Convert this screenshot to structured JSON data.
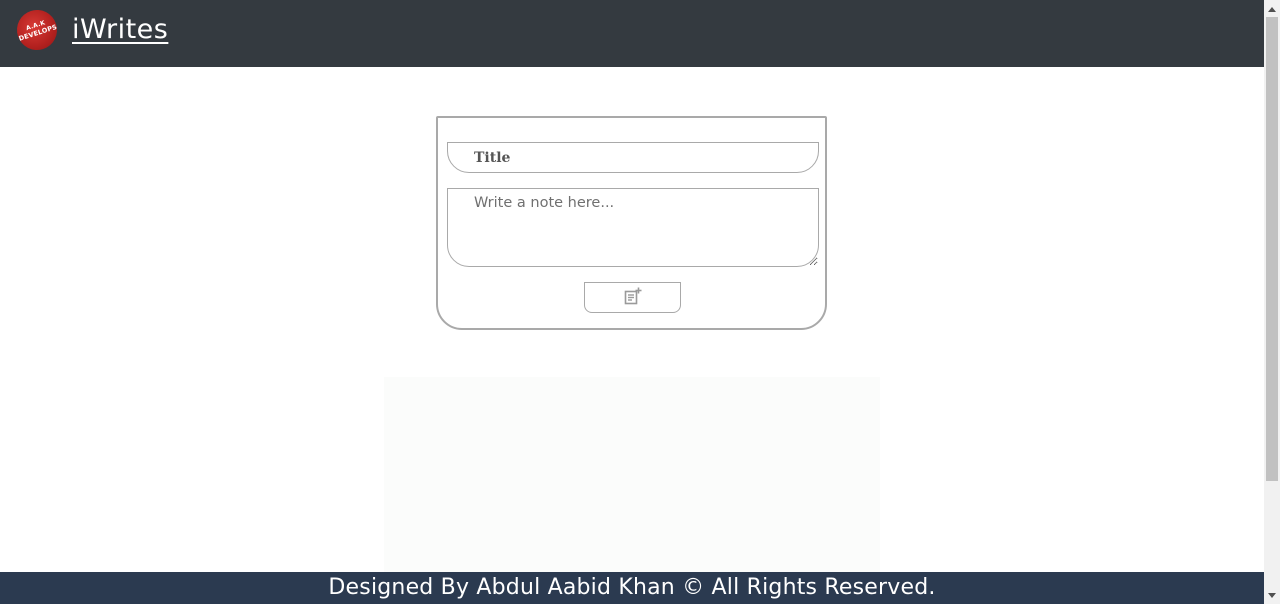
{
  "header": {
    "logo_line1": "A.A.K",
    "logo_line2": "DEVELOPS",
    "brand": "iWrites"
  },
  "form": {
    "title_placeholder": "Title",
    "note_placeholder": "Write a note here...",
    "add_button_icon": "note-add-icon"
  },
  "footer": {
    "text": "Designed By Abdul Aabid Khan © All Rights Reserved."
  },
  "colors": {
    "header_bg": "#343a40",
    "footer_bg": "#2b3a50",
    "logo_red": "#b3211f",
    "border": "#a9a9a9"
  }
}
